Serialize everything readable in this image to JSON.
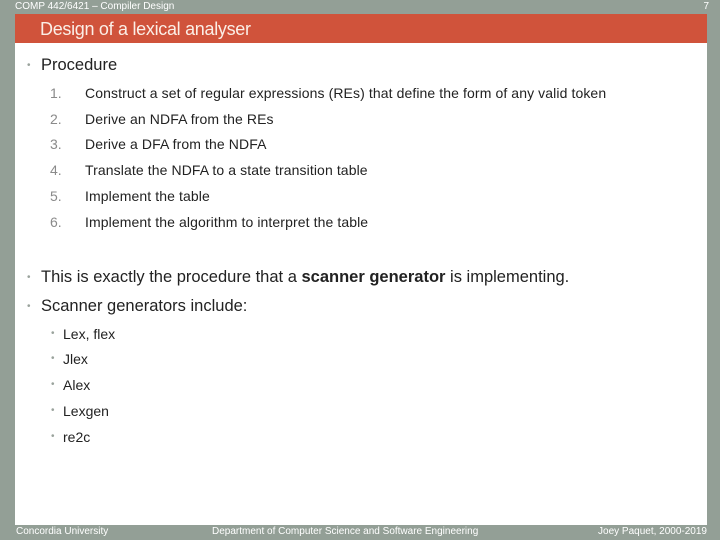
{
  "header": {
    "course": "COMP 442/6421 – Compiler Design",
    "page_number": "7"
  },
  "slide": {
    "title": "Design of a lexical analyser",
    "procedure_heading": "Procedure",
    "procedure_steps": [
      {
        "num": "1.",
        "text": "Construct a set of regular expressions (REs) that define the form of any valid token"
      },
      {
        "num": "2.",
        "text": "Derive an NDFA from the REs"
      },
      {
        "num": "3.",
        "text": "Derive a DFA from the NDFA"
      },
      {
        "num": "4.",
        "text": "Translate the NDFA to a state transition table"
      },
      {
        "num": "5.",
        "text": "Implement the table"
      },
      {
        "num": "6.",
        "text": "Implement the algorithm to interpret the table"
      }
    ],
    "statement": {
      "before": "This is exactly the procedure that a ",
      "bold": "scanner generator",
      "after": " is implementing."
    },
    "generators_heading": "Scanner generators include:",
    "generators": [
      "Lex, flex",
      "Jlex",
      "Alex",
      "Lexgen",
      "re2c"
    ],
    "bullet_icon": "bullet-dot"
  },
  "footer": {
    "left": "Concordia University",
    "center": "Department of Computer Science and Software Engineering",
    "right": "Joey Paquet, 2000-2019"
  },
  "colors": {
    "frame": "#939f96",
    "title_bar": "#d0533b",
    "title_text": "#fbeee6",
    "body_text": "#222222"
  }
}
